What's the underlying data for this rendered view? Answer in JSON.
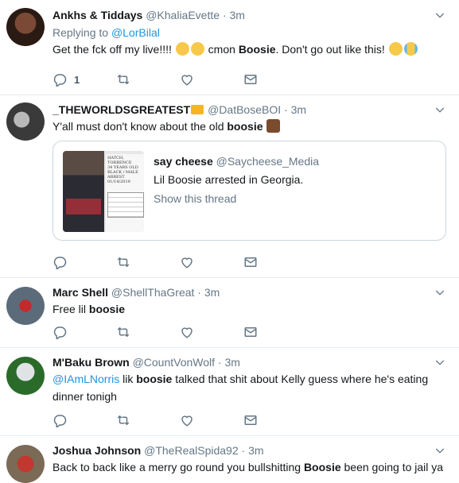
{
  "tweets": [
    {
      "name": "Ankhs & Tiddays",
      "handle": "@KhaliaEvette",
      "dot": "·",
      "time": "3m",
      "replying_prefix": "Replying to",
      "replying_to": "@LorBilal",
      "text_before": "Get the fck off my live!!!! ",
      "text_middle": " cmon ",
      "bold": "Boosie",
      "text_after": ". Don't go out like this! ",
      "emojis_1": [
        "worried-face",
        "worried-face"
      ],
      "emojis_2": [
        "tired-face",
        "loudly-crying-face"
      ],
      "reply_count": "1"
    },
    {
      "name": "_THEWORLDSGREATEST",
      "badge": "crown-emoji",
      "handle": "@DatBoseBOI",
      "dot": "·",
      "time": "3m",
      "text_before": "Y'all must don't know about the old ",
      "bold": "boosie",
      "emoji": "folded-hands-dark",
      "quote": {
        "name": "say cheese",
        "handle": "@Saycheese_Media",
        "text": "Lil Boosie arrested in Georgia.",
        "link": "Show this thread",
        "doc_lines": [
          "HATCH, TORRENCE",
          "34 YEARS OLD",
          "BLACK / MALE",
          "ARREST",
          "01/14/2019"
        ]
      }
    },
    {
      "name": "Marc Shell",
      "handle": "@ShellThaGreat",
      "dot": "·",
      "time": "3m",
      "text_before": "Free lil ",
      "bold": "boosie"
    },
    {
      "name": "M'Baku Brown",
      "handle": "@CountVonWolf",
      "dot": "·",
      "time": "3m",
      "mention": "@IAmLNorris",
      "text_before": " lik ",
      "bold": "boosie",
      "text_after": " talked that shit about Kelly guess where he's eating",
      "line2": "dinner tonigh"
    },
    {
      "name": "Joshua Johnson",
      "handle": "@TheRealSpida92",
      "dot": "·",
      "time": "3m",
      "text_before": "Back to back like a merry go round you bullshitting ",
      "bold": "Boosie",
      "text_after": " been going to jail ya"
    }
  ],
  "icons": [
    "reply-icon",
    "retweet-icon",
    "like-icon",
    "message-icon",
    "caret-down-icon"
  ],
  "colors": {
    "link": "#1b95e0",
    "secondary": "#657786",
    "border": "#e6ecf0"
  }
}
